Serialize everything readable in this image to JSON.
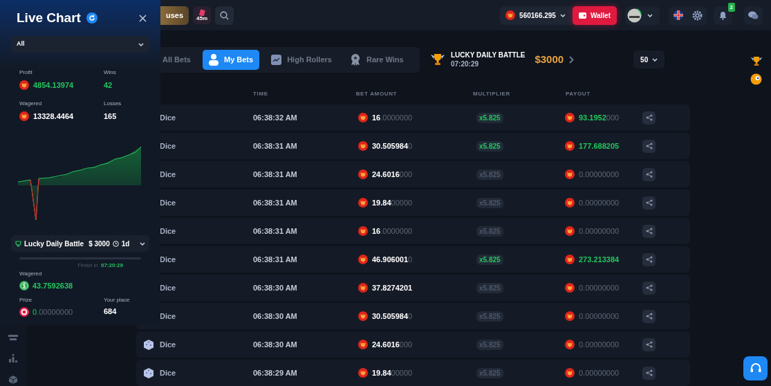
{
  "topbar": {
    "bonus_button": "uses",
    "timer_badge": "45m",
    "balance": "560166.295",
    "wallet_button": "Wallet",
    "notifications": "2"
  },
  "tabs": [
    {
      "label": "All Bets",
      "selected": false,
      "kind": "all"
    },
    {
      "label": "My Bets",
      "selected": true,
      "kind": "user"
    },
    {
      "label": "High Rollers",
      "selected": false,
      "kind": "chart"
    },
    {
      "label": "Rare Wins",
      "selected": false,
      "kind": "medal"
    }
  ],
  "battle_banner": {
    "title": "LUCKY DAILY BATTLE",
    "time": "07:20:29",
    "prize": "$3000"
  },
  "page_size": "50",
  "table": {
    "columns": [
      "TIME",
      "BET AMOUNT",
      "MULTIPLIER",
      "PAYOUT"
    ],
    "rows": [
      {
        "game": "Dice",
        "time": "06:38:32 AM",
        "amount_main": "16",
        "amount_rest": ".0000000",
        "multiplier": "x5.825",
        "win": true,
        "payout_main": "93.1952",
        "payout_rest": "000"
      },
      {
        "game": "Dice",
        "time": "06:38:31 AM",
        "amount_main": "30.505984",
        "amount_rest": "0",
        "multiplier": "x5.825",
        "win": true,
        "payout_main": "177.688205"
      },
      {
        "game": "Dice",
        "time": "06:38:31 AM",
        "amount_main": "24.6016",
        "amount_rest": "000",
        "multiplier": "x5.825",
        "win": false,
        "payout_rest": "0.00000000"
      },
      {
        "game": "Dice",
        "time": "06:38:31 AM",
        "amount_main": "19.84",
        "amount_rest": "00000",
        "multiplier": "x5.825",
        "win": false,
        "payout_rest": "0.00000000"
      },
      {
        "game": "Dice",
        "time": "06:38:31 AM",
        "amount_main": "16",
        "amount_rest": ".0000000",
        "multiplier": "x5.825",
        "win": false,
        "payout_rest": "0.00000000"
      },
      {
        "game": "Dice",
        "time": "06:38:31 AM",
        "amount_main": "46.906001",
        "amount_rest": "0",
        "multiplier": "x5.825",
        "win": true,
        "payout_main": "273.213384"
      },
      {
        "game": "Dice",
        "time": "06:38:30 AM",
        "amount_main": "37.8274201",
        "multiplier": "x5.825",
        "win": false,
        "payout_rest": "0.00000000"
      },
      {
        "game": "Dice",
        "time": "06:38:30 AM",
        "amount_main": "30.505984",
        "amount_rest": "0",
        "multiplier": "x5.825",
        "win": false,
        "payout_rest": "0.00000000"
      },
      {
        "game": "Dice",
        "time": "06:38:30 AM",
        "amount_main": "24.6016",
        "amount_rest": "000",
        "multiplier": "x5.825",
        "win": false,
        "payout_rest": "0.00000000"
      },
      {
        "game": "Dice",
        "time": "06:38:29 AM",
        "amount_main": "19.84",
        "amount_rest": "00000",
        "multiplier": "x5.825",
        "win": false,
        "payout_rest": "0.00000000"
      }
    ]
  },
  "panel": {
    "title": "Live Chart",
    "filter": "All",
    "stats": [
      {
        "label": "Profit",
        "value": "4854.13974",
        "kind": "amount",
        "positive": true
      },
      {
        "label": "Wins",
        "value": "42",
        "kind": "count",
        "positive": true
      },
      {
        "label": "Wagered",
        "value": "13328.4464",
        "kind": "amount",
        "positive": false
      },
      {
        "label": "Losses",
        "value": "165",
        "kind": "count",
        "positive": false
      }
    ],
    "battle": {
      "name": "Lucky Daily Battle",
      "prize": "$ 3000",
      "duration": "1d"
    },
    "finish_label": "Finish in",
    "finish_time": "07:20:29",
    "wagered_label": "Wagered",
    "wagered_value": "43.7592638",
    "prize_label": "Prize",
    "prize_main": "0",
    "prize_rest": ".00000000",
    "place_label": "Your place",
    "place": "684"
  }
}
